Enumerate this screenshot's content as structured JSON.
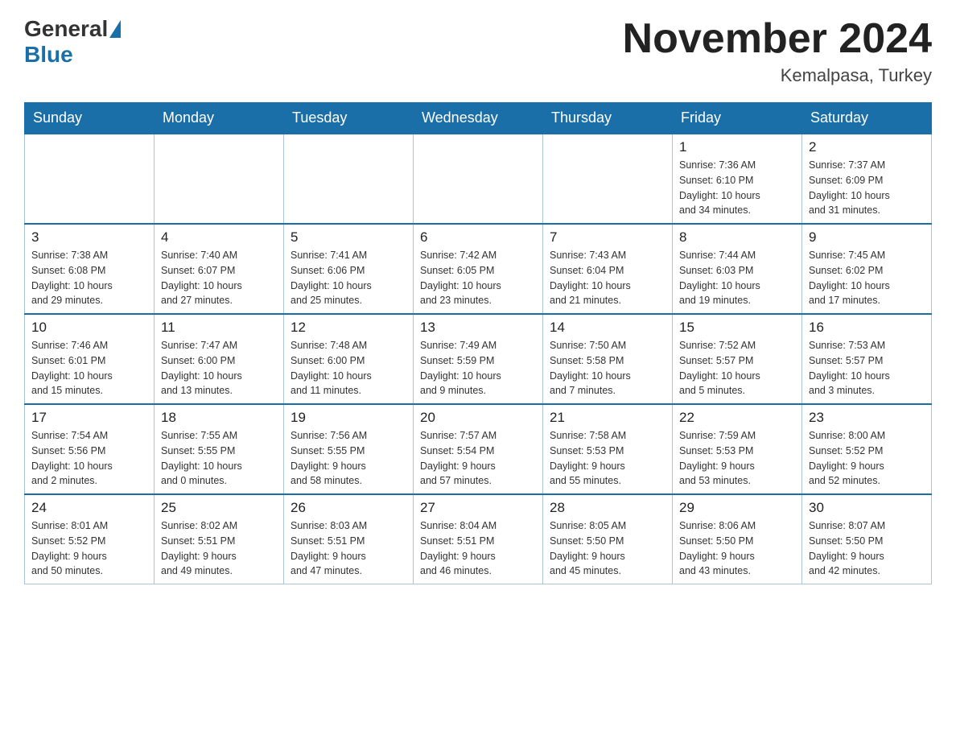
{
  "header": {
    "logo_general": "General",
    "logo_blue": "Blue",
    "month_title": "November 2024",
    "location": "Kemalpasa, Turkey"
  },
  "days_of_week": [
    "Sunday",
    "Monday",
    "Tuesday",
    "Wednesday",
    "Thursday",
    "Friday",
    "Saturday"
  ],
  "weeks": [
    [
      {
        "day": "",
        "info": ""
      },
      {
        "day": "",
        "info": ""
      },
      {
        "day": "",
        "info": ""
      },
      {
        "day": "",
        "info": ""
      },
      {
        "day": "",
        "info": ""
      },
      {
        "day": "1",
        "info": "Sunrise: 7:36 AM\nSunset: 6:10 PM\nDaylight: 10 hours\nand 34 minutes."
      },
      {
        "day": "2",
        "info": "Sunrise: 7:37 AM\nSunset: 6:09 PM\nDaylight: 10 hours\nand 31 minutes."
      }
    ],
    [
      {
        "day": "3",
        "info": "Sunrise: 7:38 AM\nSunset: 6:08 PM\nDaylight: 10 hours\nand 29 minutes."
      },
      {
        "day": "4",
        "info": "Sunrise: 7:40 AM\nSunset: 6:07 PM\nDaylight: 10 hours\nand 27 minutes."
      },
      {
        "day": "5",
        "info": "Sunrise: 7:41 AM\nSunset: 6:06 PM\nDaylight: 10 hours\nand 25 minutes."
      },
      {
        "day": "6",
        "info": "Sunrise: 7:42 AM\nSunset: 6:05 PM\nDaylight: 10 hours\nand 23 minutes."
      },
      {
        "day": "7",
        "info": "Sunrise: 7:43 AM\nSunset: 6:04 PM\nDaylight: 10 hours\nand 21 minutes."
      },
      {
        "day": "8",
        "info": "Sunrise: 7:44 AM\nSunset: 6:03 PM\nDaylight: 10 hours\nand 19 minutes."
      },
      {
        "day": "9",
        "info": "Sunrise: 7:45 AM\nSunset: 6:02 PM\nDaylight: 10 hours\nand 17 minutes."
      }
    ],
    [
      {
        "day": "10",
        "info": "Sunrise: 7:46 AM\nSunset: 6:01 PM\nDaylight: 10 hours\nand 15 minutes."
      },
      {
        "day": "11",
        "info": "Sunrise: 7:47 AM\nSunset: 6:00 PM\nDaylight: 10 hours\nand 13 minutes."
      },
      {
        "day": "12",
        "info": "Sunrise: 7:48 AM\nSunset: 6:00 PM\nDaylight: 10 hours\nand 11 minutes."
      },
      {
        "day": "13",
        "info": "Sunrise: 7:49 AM\nSunset: 5:59 PM\nDaylight: 10 hours\nand 9 minutes."
      },
      {
        "day": "14",
        "info": "Sunrise: 7:50 AM\nSunset: 5:58 PM\nDaylight: 10 hours\nand 7 minutes."
      },
      {
        "day": "15",
        "info": "Sunrise: 7:52 AM\nSunset: 5:57 PM\nDaylight: 10 hours\nand 5 minutes."
      },
      {
        "day": "16",
        "info": "Sunrise: 7:53 AM\nSunset: 5:57 PM\nDaylight: 10 hours\nand 3 minutes."
      }
    ],
    [
      {
        "day": "17",
        "info": "Sunrise: 7:54 AM\nSunset: 5:56 PM\nDaylight: 10 hours\nand 2 minutes."
      },
      {
        "day": "18",
        "info": "Sunrise: 7:55 AM\nSunset: 5:55 PM\nDaylight: 10 hours\nand 0 minutes."
      },
      {
        "day": "19",
        "info": "Sunrise: 7:56 AM\nSunset: 5:55 PM\nDaylight: 9 hours\nand 58 minutes."
      },
      {
        "day": "20",
        "info": "Sunrise: 7:57 AM\nSunset: 5:54 PM\nDaylight: 9 hours\nand 57 minutes."
      },
      {
        "day": "21",
        "info": "Sunrise: 7:58 AM\nSunset: 5:53 PM\nDaylight: 9 hours\nand 55 minutes."
      },
      {
        "day": "22",
        "info": "Sunrise: 7:59 AM\nSunset: 5:53 PM\nDaylight: 9 hours\nand 53 minutes."
      },
      {
        "day": "23",
        "info": "Sunrise: 8:00 AM\nSunset: 5:52 PM\nDaylight: 9 hours\nand 52 minutes."
      }
    ],
    [
      {
        "day": "24",
        "info": "Sunrise: 8:01 AM\nSunset: 5:52 PM\nDaylight: 9 hours\nand 50 minutes."
      },
      {
        "day": "25",
        "info": "Sunrise: 8:02 AM\nSunset: 5:51 PM\nDaylight: 9 hours\nand 49 minutes."
      },
      {
        "day": "26",
        "info": "Sunrise: 8:03 AM\nSunset: 5:51 PM\nDaylight: 9 hours\nand 47 minutes."
      },
      {
        "day": "27",
        "info": "Sunrise: 8:04 AM\nSunset: 5:51 PM\nDaylight: 9 hours\nand 46 minutes."
      },
      {
        "day": "28",
        "info": "Sunrise: 8:05 AM\nSunset: 5:50 PM\nDaylight: 9 hours\nand 45 minutes."
      },
      {
        "day": "29",
        "info": "Sunrise: 8:06 AM\nSunset: 5:50 PM\nDaylight: 9 hours\nand 43 minutes."
      },
      {
        "day": "30",
        "info": "Sunrise: 8:07 AM\nSunset: 5:50 PM\nDaylight: 9 hours\nand 42 minutes."
      }
    ]
  ]
}
